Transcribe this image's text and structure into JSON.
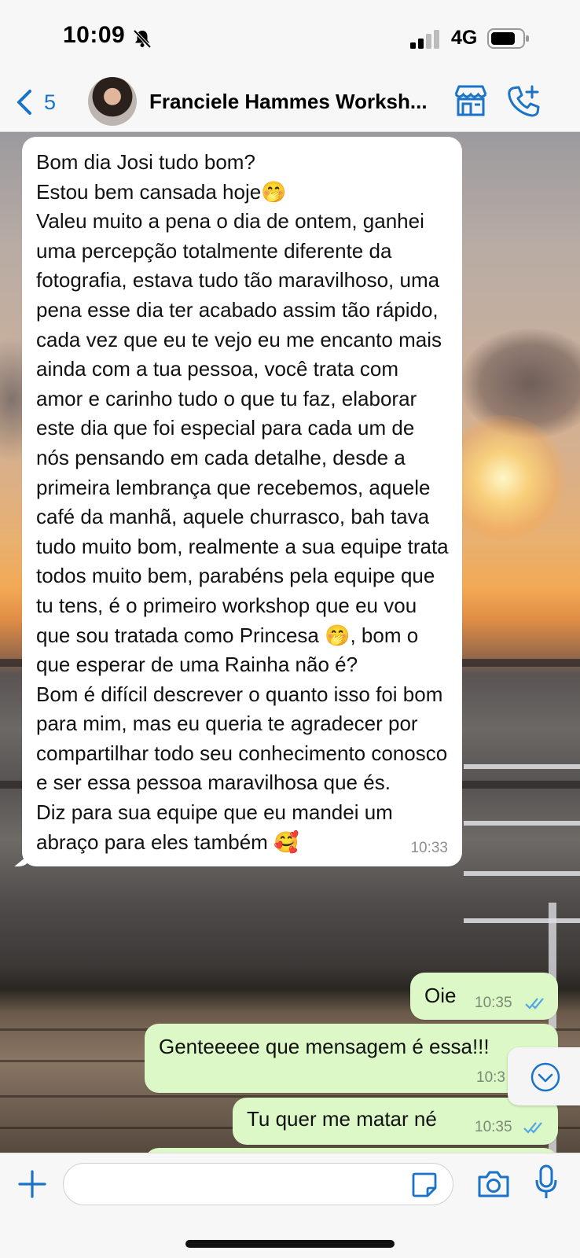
{
  "status_bar": {
    "time": "10:09",
    "network": "4G"
  },
  "header": {
    "back_count": "5",
    "contact_name": "Franciele Hammes Workshop",
    "contact_name_display": "Franciele Hammes Worksh..."
  },
  "messages": [
    {
      "direction": "incoming",
      "text": "Bom dia Josi tudo bom?\nEstou bem cansada hoje🤭\nValeu muito a pena o dia de ontem, ganhei uma percepção totalmente diferente da fotografia, estava tudo tão maravilhoso, uma pena esse dia ter acabado assim tão rápido, cada vez que eu te vejo eu me encanto mais ainda com a tua pessoa, você trata com amor e carinho tudo o que tu faz, elaborar este dia que foi especial para cada um de nós pensando em cada detalhe, desde a primeira lembrança que recebemos, aquele café da manhã, aquele churrasco, bah tava tudo muito bom, realmente a sua equipe trata todos muito bem, parabéns pela equipe que tu tens, é o primeiro workshop que eu vou que sou tratada como Princesa 🤭, bom o que esperar de uma Rainha não é?\nBom é difícil descrever o quanto isso foi bom para mim, mas eu queria te agradecer por compartilhar todo seu conhecimento conosco e ser essa pessoa maravilhosa que és.\nDiz para sua equipe que eu mandei um abraço para eles também 🥰",
      "time": "10:33"
    },
    {
      "direction": "outgoing",
      "text": "Oie",
      "time": "10:35",
      "status": "read"
    },
    {
      "direction": "outgoing",
      "text": "Genteeeee que mensagem é essa!!!",
      "time": "10:3"
    },
    {
      "direction": "outgoing",
      "text": "Tu quer me matar né",
      "time": "10:35",
      "status": "read"
    }
  ],
  "input": {
    "placeholder": "",
    "value": ""
  },
  "colors": {
    "accent": "#1a73c7",
    "outgoing_bubble": "#dcf8c6",
    "incoming_bubble": "#ffffff",
    "read_ticks": "#53a6e6"
  },
  "icons": {
    "back": "chevron-left-icon",
    "store": "storefront-icon",
    "call": "phone-plus-icon",
    "scroll_down": "chevron-down-circle-icon",
    "plus": "plus-icon",
    "sticker": "sticker-icon",
    "camera": "camera-icon",
    "mic": "microphone-icon"
  }
}
